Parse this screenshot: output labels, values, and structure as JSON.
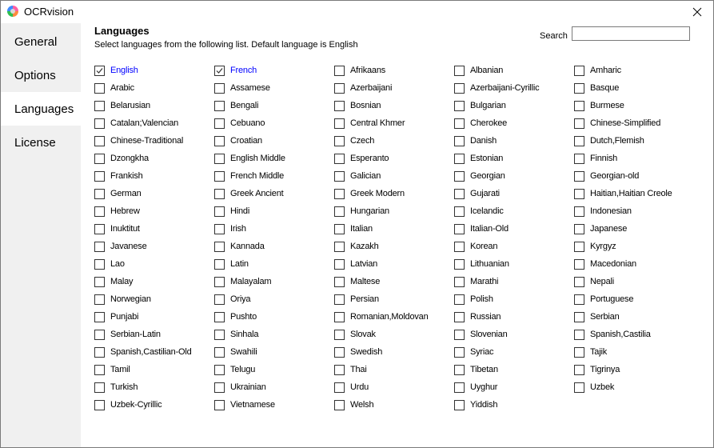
{
  "window": {
    "title": "OCRvision",
    "icon": "app-logo-icon",
    "close_icon": "close-icon"
  },
  "sidebar": {
    "items": [
      {
        "label": "General",
        "selected": false
      },
      {
        "label": "Options",
        "selected": false
      },
      {
        "label": "Languages",
        "selected": true
      },
      {
        "label": "License",
        "selected": false
      }
    ]
  },
  "page": {
    "title": "Languages",
    "subtitle": "Select languages from the following list. Default language is English",
    "search": {
      "label": "Search",
      "value": "",
      "placeholder": ""
    }
  },
  "colors": {
    "checked_label": "#0000ff",
    "sidebar_bg": "#f0f0f0",
    "selected_nav_bg": "#ffffff"
  },
  "languages": [
    {
      "label": "English",
      "checked": true
    },
    {
      "label": "French",
      "checked": true
    },
    {
      "label": "Afrikaans",
      "checked": false
    },
    {
      "label": "Albanian",
      "checked": false
    },
    {
      "label": "Amharic",
      "checked": false
    },
    {
      "label": "Arabic",
      "checked": false
    },
    {
      "label": "Assamese",
      "checked": false
    },
    {
      "label": "Azerbaijani",
      "checked": false
    },
    {
      "label": "Azerbaijani-Cyrillic",
      "checked": false
    },
    {
      "label": "Basque",
      "checked": false
    },
    {
      "label": "Belarusian",
      "checked": false
    },
    {
      "label": "Bengali",
      "checked": false
    },
    {
      "label": "Bosnian",
      "checked": false
    },
    {
      "label": "Bulgarian",
      "checked": false
    },
    {
      "label": "Burmese",
      "checked": false
    },
    {
      "label": "Catalan;Valencian",
      "checked": false
    },
    {
      "label": "Cebuano",
      "checked": false
    },
    {
      "label": "Central Khmer",
      "checked": false
    },
    {
      "label": "Cherokee",
      "checked": false
    },
    {
      "label": "Chinese-Simplified",
      "checked": false
    },
    {
      "label": "Chinese-Traditional",
      "checked": false
    },
    {
      "label": "Croatian",
      "checked": false
    },
    {
      "label": "Czech",
      "checked": false
    },
    {
      "label": "Danish",
      "checked": false
    },
    {
      "label": "Dutch,Flemish",
      "checked": false
    },
    {
      "label": "Dzongkha",
      "checked": false
    },
    {
      "label": "English Middle",
      "checked": false
    },
    {
      "label": "Esperanto",
      "checked": false
    },
    {
      "label": "Estonian",
      "checked": false
    },
    {
      "label": "Finnish",
      "checked": false
    },
    {
      "label": "Frankish",
      "checked": false
    },
    {
      "label": "French Middle",
      "checked": false
    },
    {
      "label": "Galician",
      "checked": false
    },
    {
      "label": "Georgian",
      "checked": false
    },
    {
      "label": "Georgian-old",
      "checked": false
    },
    {
      "label": "German",
      "checked": false
    },
    {
      "label": "Greek Ancient",
      "checked": false
    },
    {
      "label": "Greek Modern",
      "checked": false
    },
    {
      "label": "Gujarati",
      "checked": false
    },
    {
      "label": "Haitian,Haitian Creole",
      "checked": false
    },
    {
      "label": "Hebrew",
      "checked": false
    },
    {
      "label": "Hindi",
      "checked": false
    },
    {
      "label": "Hungarian",
      "checked": false
    },
    {
      "label": "Icelandic",
      "checked": false
    },
    {
      "label": "Indonesian",
      "checked": false
    },
    {
      "label": "Inuktitut",
      "checked": false
    },
    {
      "label": "Irish",
      "checked": false
    },
    {
      "label": "Italian",
      "checked": false
    },
    {
      "label": "Italian-Old",
      "checked": false
    },
    {
      "label": "Japanese",
      "checked": false
    },
    {
      "label": "Javanese",
      "checked": false
    },
    {
      "label": "Kannada",
      "checked": false
    },
    {
      "label": "Kazakh",
      "checked": false
    },
    {
      "label": "Korean",
      "checked": false
    },
    {
      "label": "Kyrgyz",
      "checked": false
    },
    {
      "label": "Lao",
      "checked": false
    },
    {
      "label": "Latin",
      "checked": false
    },
    {
      "label": "Latvian",
      "checked": false
    },
    {
      "label": "Lithuanian",
      "checked": false
    },
    {
      "label": "Macedonian",
      "checked": false
    },
    {
      "label": "Malay",
      "checked": false
    },
    {
      "label": "Malayalam",
      "checked": false
    },
    {
      "label": "Maltese",
      "checked": false
    },
    {
      "label": "Marathi",
      "checked": false
    },
    {
      "label": "Nepali",
      "checked": false
    },
    {
      "label": "Norwegian",
      "checked": false
    },
    {
      "label": "Oriya",
      "checked": false
    },
    {
      "label": "Persian",
      "checked": false
    },
    {
      "label": "Polish",
      "checked": false
    },
    {
      "label": "Portuguese",
      "checked": false
    },
    {
      "label": "Punjabi",
      "checked": false
    },
    {
      "label": "Pushto",
      "checked": false
    },
    {
      "label": "Romanian,Moldovan",
      "checked": false
    },
    {
      "label": "Russian",
      "checked": false
    },
    {
      "label": "Serbian",
      "checked": false
    },
    {
      "label": "Serbian-Latin",
      "checked": false
    },
    {
      "label": "Sinhala",
      "checked": false
    },
    {
      "label": "Slovak",
      "checked": false
    },
    {
      "label": "Slovenian",
      "checked": false
    },
    {
      "label": "Spanish,Castilia",
      "checked": false
    },
    {
      "label": "Spanish,Castilian-Old",
      "checked": false
    },
    {
      "label": "Swahili",
      "checked": false
    },
    {
      "label": "Swedish",
      "checked": false
    },
    {
      "label": "Syriac",
      "checked": false
    },
    {
      "label": "Tajik",
      "checked": false
    },
    {
      "label": "Tamil",
      "checked": false
    },
    {
      "label": "Telugu",
      "checked": false
    },
    {
      "label": "Thai",
      "checked": false
    },
    {
      "label": "Tibetan",
      "checked": false
    },
    {
      "label": "Tigrinya",
      "checked": false
    },
    {
      "label": "Turkish",
      "checked": false
    },
    {
      "label": "Ukrainian",
      "checked": false
    },
    {
      "label": "Urdu",
      "checked": false
    },
    {
      "label": "Uyghur",
      "checked": false
    },
    {
      "label": "Uzbek",
      "checked": false
    },
    {
      "label": "Uzbek-Cyrillic",
      "checked": false
    },
    {
      "label": "Vietnamese",
      "checked": false
    },
    {
      "label": "Welsh",
      "checked": false
    },
    {
      "label": "Yiddish",
      "checked": false
    }
  ]
}
